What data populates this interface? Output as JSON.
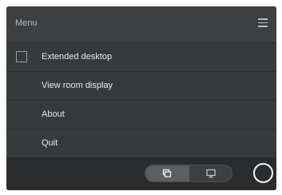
{
  "header": {
    "title": "Menu",
    "menu_icon": "hamburger-icon"
  },
  "menu": {
    "items": [
      {
        "label": "Extended desktop",
        "has_checkbox": true,
        "checked": false
      },
      {
        "label": "View room display",
        "has_checkbox": false
      },
      {
        "label": "About",
        "has_checkbox": false
      },
      {
        "label": "Quit",
        "has_checkbox": false
      }
    ]
  },
  "footer": {
    "segmented_control": {
      "options": [
        {
          "icon": "windows-icon",
          "selected": true
        },
        {
          "icon": "monitor-icon",
          "selected": false
        }
      ]
    },
    "circle_button_icon": "circle-icon"
  },
  "colors": {
    "window_bg": "#2a2c2d",
    "header_bg": "#3d3f40",
    "item_bg": "#373a3b",
    "text": "#e6e8e9",
    "muted_text": "#b9bcbe"
  }
}
